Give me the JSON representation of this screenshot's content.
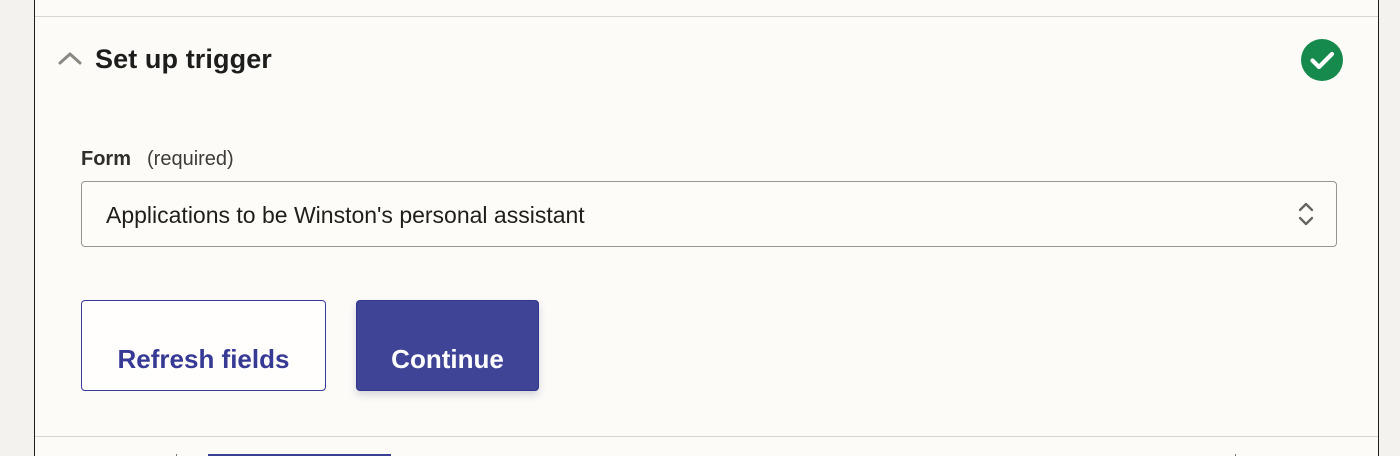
{
  "section": {
    "title": "Set up trigger",
    "collapse_icon": "chevron-up-icon",
    "status_icon": "check-circle-icon",
    "status_color": "#168a4d"
  },
  "form": {
    "label": "Form",
    "required": "(required)",
    "selected_value": "Applications to be Winston's personal assistant",
    "select_icon": "chevron-up-down-icon"
  },
  "actions": {
    "refresh_label": "Refresh fields",
    "continue_label": "Continue"
  },
  "colors": {
    "page_background": "#f3f2ef",
    "panel_background": "#fcfbf8",
    "primary": "#3f4496",
    "primary_border": "#383a98",
    "divider": "#d8d6d1"
  }
}
